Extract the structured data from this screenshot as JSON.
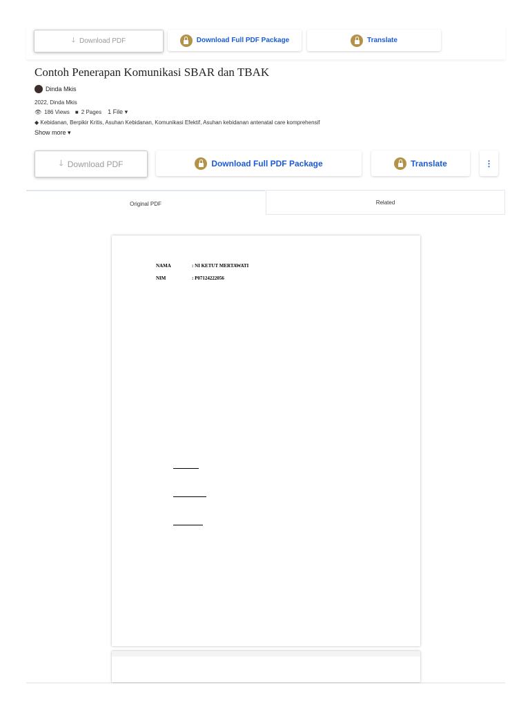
{
  "top_bar": {
    "download_pdf": "Download PDF",
    "download_package": "Download Full PDF Package",
    "translate": "Translate"
  },
  "doc": {
    "title": "Contoh Penerapan Komunikasi SBAR dan TBAK",
    "author": "Dinda Mkis",
    "year_author": "2022, Dinda Mkis",
    "views": "186 Views",
    "pages": "2 Pages",
    "files": "1 File",
    "tags": "Kebidanan, Berpikir Kritis, Asuhan Kebidanan, Komunikasi Efektif, Asuhan kebidanan antenatal care komprehensif",
    "show_more": "Show more"
  },
  "actions": {
    "download_pdf": "Download PDF",
    "download_package": "Download Full PDF Package",
    "translate": "Translate",
    "more": "⋮"
  },
  "tabs": [
    {
      "label": "Original PDF"
    },
    {
      "label": "Related"
    }
  ],
  "pdf": {
    "nama_label": "NAMA",
    "nama_value": ": NI KETUT MERTAWATI",
    "nim_label": "NIM",
    "nim_value": ": P07124222056"
  }
}
